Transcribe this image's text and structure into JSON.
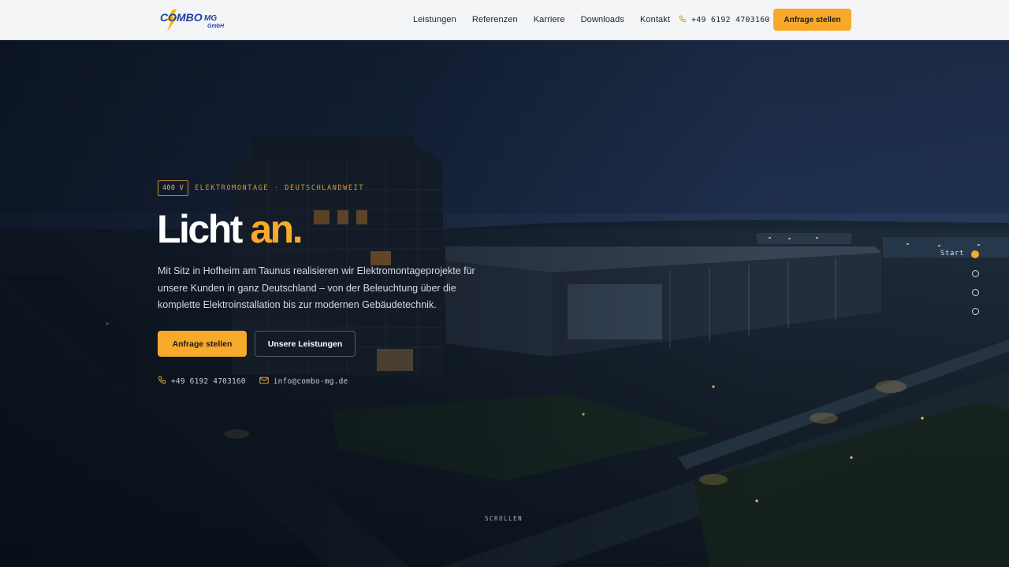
{
  "brand": {
    "name": "COMBO",
    "name_suffix": "MG",
    "legal_form": "GmbH",
    "accent_color": "#f7a92c",
    "logo_blue": "#1f3fa0"
  },
  "nav": {
    "links": [
      "Leistungen",
      "Referenzen",
      "Karriere",
      "Downloads",
      "Kontakt"
    ],
    "phone": "+49 6192 4703160",
    "phone_icon": "phone-icon",
    "cta_label": "Anfrage stellen"
  },
  "hero": {
    "badge": "400 V",
    "eyebrow": "ELEKTROMONTAGE · DEUTSCHLANDWEIT",
    "headline_part1": "Licht",
    "headline_part2": "an.",
    "lead": "Mit Sitz in Hofheim am Taunus realisieren wir Elektromontageprojekte für unsere Kunden in ganz Deutschland – von der Beleuchtung über die komplette Elektroinstallation bis zur modernen Gebäudetechnik.",
    "primary_button": "Anfrage stellen",
    "secondary_button": "Unsere Leistungen",
    "contact_phone": "+49 6192 4703160",
    "contact_email": "info@combo-mg.de",
    "background": "night aerial photo of an office building and industrial hall"
  },
  "side_nav": {
    "active_label": "Start",
    "dot_count": 4
  },
  "scroll_hint": "SCROLLEN"
}
